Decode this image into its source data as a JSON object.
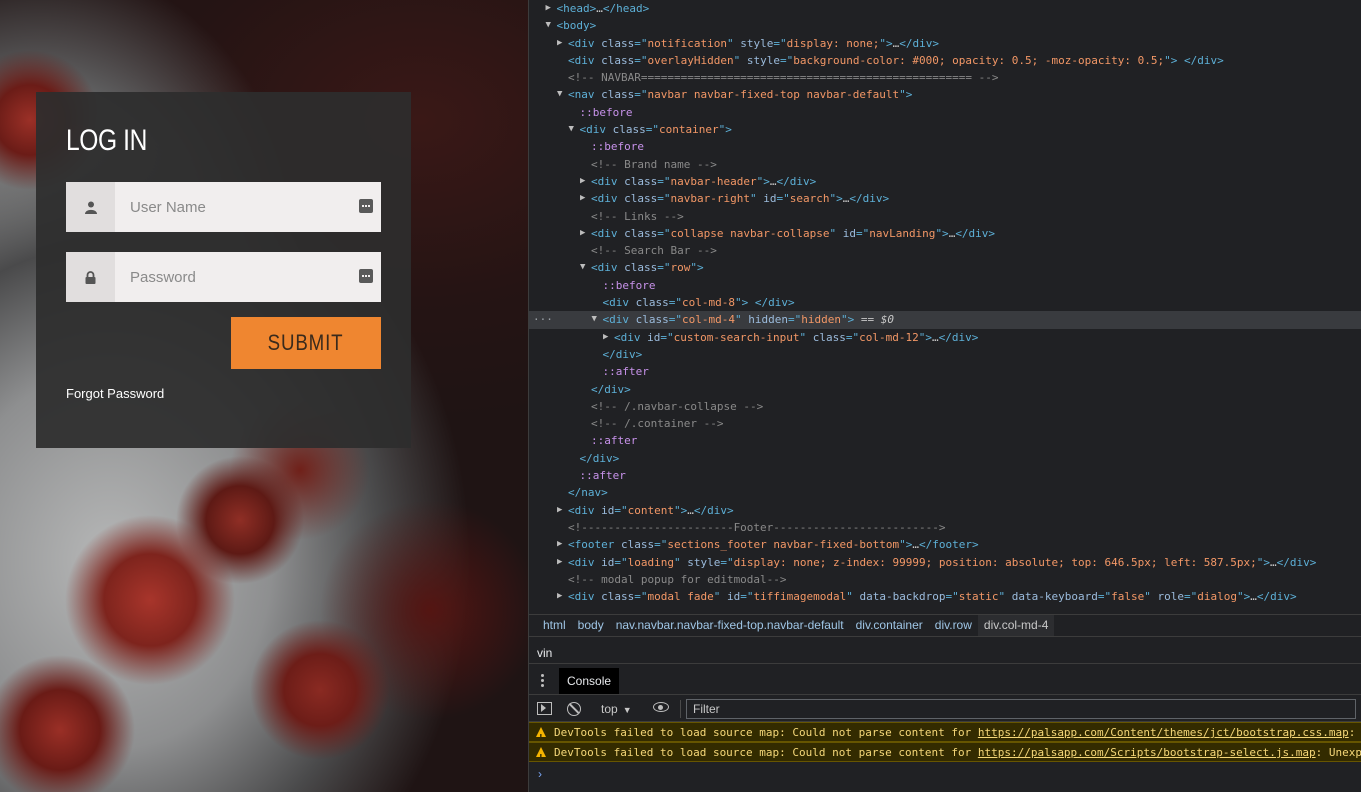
{
  "login": {
    "title": "LOG IN",
    "username_placeholder": "User Name",
    "password_placeholder": "Password",
    "submit_label": "SUBMIT",
    "forgot_label": "Forgot Password",
    "accent_color": "#ef8630"
  },
  "devtools": {
    "dom_lines": [
      {
        "indent": 1,
        "toggle": "collapsed",
        "segments": [
          [
            "tg",
            "<head>"
          ],
          [
            "eq",
            "…"
          ],
          [
            "tg",
            "</head>"
          ]
        ]
      },
      {
        "indent": 1,
        "toggle": "expanded",
        "segments": [
          [
            "tg",
            "<body>"
          ]
        ]
      },
      {
        "indent": 2,
        "toggle": "collapsed",
        "segments": [
          [
            "tg",
            "<div "
          ],
          [
            "an",
            "class"
          ],
          [
            "tg",
            "=\""
          ],
          [
            "av",
            "notification"
          ],
          [
            "tg",
            "\" "
          ],
          [
            "an",
            "style"
          ],
          [
            "tg",
            "=\""
          ],
          [
            "av",
            "display: none;"
          ],
          [
            "tg",
            "\">"
          ],
          [
            "eq",
            "…"
          ],
          [
            "tg",
            "</div>"
          ]
        ]
      },
      {
        "indent": 2,
        "toggle": "none",
        "segments": [
          [
            "tg",
            "<div "
          ],
          [
            "an",
            "class"
          ],
          [
            "tg",
            "=\""
          ],
          [
            "av",
            "overlayHidden"
          ],
          [
            "tg",
            "\" "
          ],
          [
            "an",
            "style"
          ],
          [
            "tg",
            "=\""
          ],
          [
            "av",
            "background-color: #000; opacity: 0.5; -moz-opacity: 0.5;"
          ],
          [
            "tg",
            "\"> </div>"
          ]
        ]
      },
      {
        "indent": 2,
        "toggle": "none",
        "segments": [
          [
            "cm",
            "<!-- NAVBAR================================================== -->"
          ]
        ]
      },
      {
        "indent": 2,
        "toggle": "expanded",
        "segments": [
          [
            "tg",
            "<nav "
          ],
          [
            "an",
            "class"
          ],
          [
            "tg",
            "=\""
          ],
          [
            "av",
            "navbar navbar-fixed-top navbar-default"
          ],
          [
            "tg",
            "\">"
          ]
        ]
      },
      {
        "indent": 3,
        "toggle": "none",
        "segments": [
          [
            "ps",
            "::before"
          ]
        ]
      },
      {
        "indent": 3,
        "toggle": "expanded",
        "segments": [
          [
            "tg",
            "<div "
          ],
          [
            "an",
            "class"
          ],
          [
            "tg",
            "=\""
          ],
          [
            "av",
            "container"
          ],
          [
            "tg",
            "\">"
          ]
        ]
      },
      {
        "indent": 4,
        "toggle": "none",
        "segments": [
          [
            "ps",
            "::before"
          ]
        ]
      },
      {
        "indent": 4,
        "toggle": "none",
        "segments": [
          [
            "cm",
            "<!-- Brand name -->"
          ]
        ]
      },
      {
        "indent": 4,
        "toggle": "collapsed",
        "segments": [
          [
            "tg",
            "<div "
          ],
          [
            "an",
            "class"
          ],
          [
            "tg",
            "=\""
          ],
          [
            "av",
            "navbar-header"
          ],
          [
            "tg",
            "\">"
          ],
          [
            "eq",
            "…"
          ],
          [
            "tg",
            "</div>"
          ]
        ]
      },
      {
        "indent": 4,
        "toggle": "collapsed",
        "segments": [
          [
            "tg",
            "<div "
          ],
          [
            "an",
            "class"
          ],
          [
            "tg",
            "=\""
          ],
          [
            "av",
            "navbar-right"
          ],
          [
            "tg",
            "\" "
          ],
          [
            "an",
            "id"
          ],
          [
            "tg",
            "=\""
          ],
          [
            "av",
            "search"
          ],
          [
            "tg",
            "\">"
          ],
          [
            "eq",
            "…"
          ],
          [
            "tg",
            "</div>"
          ]
        ]
      },
      {
        "indent": 4,
        "toggle": "none",
        "segments": [
          [
            "cm",
            "<!-- Links -->"
          ]
        ]
      },
      {
        "indent": 4,
        "toggle": "collapsed",
        "segments": [
          [
            "tg",
            "<div "
          ],
          [
            "an",
            "class"
          ],
          [
            "tg",
            "=\""
          ],
          [
            "av",
            "collapse navbar-collapse"
          ],
          [
            "tg",
            "\" "
          ],
          [
            "an",
            "id"
          ],
          [
            "tg",
            "=\""
          ],
          [
            "av",
            "navLanding"
          ],
          [
            "tg",
            "\">"
          ],
          [
            "eq",
            "…"
          ],
          [
            "tg",
            "</div>"
          ]
        ]
      },
      {
        "indent": 4,
        "toggle": "none",
        "segments": [
          [
            "cm",
            "<!-- Search Bar -->"
          ]
        ]
      },
      {
        "indent": 4,
        "toggle": "expanded",
        "segments": [
          [
            "tg",
            "<div "
          ],
          [
            "an",
            "class"
          ],
          [
            "tg",
            "=\""
          ],
          [
            "av",
            "row"
          ],
          [
            "tg",
            "\">"
          ]
        ]
      },
      {
        "indent": 5,
        "toggle": "none",
        "segments": [
          [
            "ps",
            "::before"
          ]
        ]
      },
      {
        "indent": 5,
        "toggle": "none",
        "segments": [
          [
            "tg",
            "<div "
          ],
          [
            "an",
            "class"
          ],
          [
            "tg",
            "=\""
          ],
          [
            "av",
            "col-md-8"
          ],
          [
            "tg",
            "\"> </div>"
          ]
        ]
      },
      {
        "indent": 5,
        "toggle": "expanded",
        "selected": true,
        "segments": [
          [
            "tg",
            "<div "
          ],
          [
            "an",
            "class"
          ],
          [
            "tg",
            "=\""
          ],
          [
            "av",
            "col-md-4"
          ],
          [
            "tg",
            "\" "
          ],
          [
            "an",
            "hidden"
          ],
          [
            "tg",
            "=\""
          ],
          [
            "av",
            "hidden"
          ],
          [
            "tg",
            "\">"
          ],
          [
            "eq",
            " == "
          ],
          [
            "d0",
            "$0"
          ]
        ]
      },
      {
        "indent": 6,
        "toggle": "collapsed",
        "segments": [
          [
            "tg",
            "<div "
          ],
          [
            "an",
            "id"
          ],
          [
            "tg",
            "=\""
          ],
          [
            "av",
            "custom-search-input"
          ],
          [
            "tg",
            "\" "
          ],
          [
            "an",
            "class"
          ],
          [
            "tg",
            "=\""
          ],
          [
            "av",
            "col-md-12"
          ],
          [
            "tg",
            "\">"
          ],
          [
            "eq",
            "…"
          ],
          [
            "tg",
            "</div>"
          ]
        ]
      },
      {
        "indent": 5,
        "toggle": "none",
        "segments": [
          [
            "tg",
            "</div>"
          ]
        ]
      },
      {
        "indent": 5,
        "toggle": "none",
        "segments": [
          [
            "ps",
            "::after"
          ]
        ]
      },
      {
        "indent": 4,
        "toggle": "none",
        "segments": [
          [
            "tg",
            "</div>"
          ]
        ]
      },
      {
        "indent": 4,
        "toggle": "none",
        "segments": [
          [
            "cm",
            "<!-- /.navbar-collapse -->"
          ]
        ]
      },
      {
        "indent": 4,
        "toggle": "none",
        "segments": [
          [
            "cm",
            "<!-- /.container -->"
          ]
        ]
      },
      {
        "indent": 4,
        "toggle": "none",
        "segments": [
          [
            "ps",
            "::after"
          ]
        ]
      },
      {
        "indent": 3,
        "toggle": "none",
        "segments": [
          [
            "tg",
            "</div>"
          ]
        ]
      },
      {
        "indent": 3,
        "toggle": "none",
        "segments": [
          [
            "ps",
            "::after"
          ]
        ]
      },
      {
        "indent": 2,
        "toggle": "none",
        "segments": [
          [
            "tg",
            "</nav>"
          ]
        ]
      },
      {
        "indent": 2,
        "toggle": "collapsed",
        "segments": [
          [
            "tg",
            "<div "
          ],
          [
            "an",
            "id"
          ],
          [
            "tg",
            "=\""
          ],
          [
            "av",
            "content"
          ],
          [
            "tg",
            "\">"
          ],
          [
            "eq",
            "…"
          ],
          [
            "tg",
            "</div>"
          ]
        ]
      },
      {
        "indent": 2,
        "toggle": "none",
        "segments": [
          [
            "cm",
            "<!-----------------------Footer------------------------->"
          ]
        ]
      },
      {
        "indent": 2,
        "toggle": "collapsed",
        "segments": [
          [
            "tg",
            "<footer "
          ],
          [
            "an",
            "class"
          ],
          [
            "tg",
            "=\""
          ],
          [
            "av",
            "sections_footer navbar-fixed-bottom"
          ],
          [
            "tg",
            "\">"
          ],
          [
            "eq",
            "…"
          ],
          [
            "tg",
            "</footer>"
          ]
        ]
      },
      {
        "indent": 2,
        "toggle": "collapsed",
        "segments": [
          [
            "tg",
            "<div "
          ],
          [
            "an",
            "id"
          ],
          [
            "tg",
            "=\""
          ],
          [
            "av",
            "loading"
          ],
          [
            "tg",
            "\" "
          ],
          [
            "an",
            "style"
          ],
          [
            "tg",
            "=\""
          ],
          [
            "av",
            "display: none; z-index: 99999; position: absolute; top: 646.5px; left: 587.5px;"
          ],
          [
            "tg",
            "\">"
          ],
          [
            "eq",
            "…"
          ],
          [
            "tg",
            "</div>"
          ]
        ]
      },
      {
        "indent": 2,
        "toggle": "none",
        "segments": [
          [
            "cm",
            "<!-- modal popup for editmodal-->"
          ]
        ]
      },
      {
        "indent": 2,
        "toggle": "collapsed",
        "segments": [
          [
            "tg",
            "<div "
          ],
          [
            "an",
            "class"
          ],
          [
            "tg",
            "=\""
          ],
          [
            "av",
            "modal fade"
          ],
          [
            "tg",
            "\" "
          ],
          [
            "an",
            "id"
          ],
          [
            "tg",
            "=\""
          ],
          [
            "av",
            "tiffimagemodal"
          ],
          [
            "tg",
            "\" "
          ],
          [
            "an",
            "data-backdrop"
          ],
          [
            "tg",
            "=\""
          ],
          [
            "av",
            "static"
          ],
          [
            "tg",
            "\" "
          ],
          [
            "an",
            "data-keyboard"
          ],
          [
            "tg",
            "=\""
          ],
          [
            "av",
            "false"
          ],
          [
            "tg",
            "\" "
          ],
          [
            "an",
            "role"
          ],
          [
            "tg",
            "=\""
          ],
          [
            "av",
            "dialog"
          ],
          [
            "tg",
            "\">"
          ],
          [
            "eq",
            "…"
          ],
          [
            "tg",
            "</div>"
          ]
        ]
      }
    ],
    "breadcrumbs": [
      "html",
      "body",
      "nav.navbar.navbar-fixed-top.navbar-default",
      "div.container",
      "div.row",
      "div.col-md-4"
    ],
    "search_value": "vin",
    "drawer_tab": "Console",
    "context": "top",
    "filter_placeholder": "Filter",
    "warnings": [
      {
        "prefix": "DevTools failed to load source map: Could not parse content for ",
        "url": "https://palsapp.com/Content/themes/jct/bootstrap.css.map",
        "suffix": ": U"
      },
      {
        "prefix": "DevTools failed to load source map: Could not parse content for ",
        "url": "https://palsapp.com/Scripts/bootstrap-select.js.map",
        "suffix": ": Unexpe"
      }
    ],
    "prompt": "›"
  }
}
